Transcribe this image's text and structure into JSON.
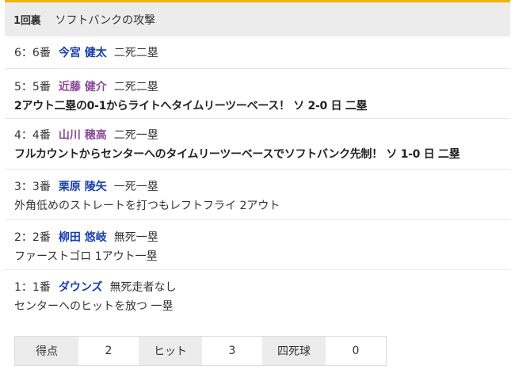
{
  "inning": {
    "label": "1回裏",
    "title": "ソフトバンクの攻撃"
  },
  "plays": [
    {
      "order": "6：6番",
      "batter": "今宮 健太",
      "situation": "二死二塁",
      "result": ""
    },
    {
      "order": "5：5番",
      "batter": "近藤 健介",
      "situation": "二死二塁",
      "result": "2アウト二塁の0-1からライトへタイムリーツーベース！ ソ 2-0 日 二塁"
    },
    {
      "order": "4：4番",
      "batter": "山川 穂高",
      "situation": "二死一塁",
      "result": "フルカウントからセンターへのタイムリーツーベースでソフトバンク先制！ ソ 1-0 日 二塁"
    },
    {
      "order": "3：3番",
      "batter": "栗原 陵矢",
      "situation": "一死一塁",
      "result": "外角低めのストレートを打つもレフトフライ 2アウト"
    },
    {
      "order": "2：2番",
      "batter": "柳田 悠岐",
      "situation": "無死一塁",
      "result": "ファーストゴロ 1アウト一塁"
    },
    {
      "order": "1：1番",
      "batter": "ダウンズ",
      "situation": "無死走者なし",
      "result": "センターへのヒットを放つ 一塁"
    }
  ],
  "summary": {
    "runs_label": "得点",
    "runs": "2",
    "hits_label": "ヒット",
    "hits": "3",
    "walks_label": "四死球",
    "walks": "0"
  },
  "colors": {
    "accent": "#f2b400",
    "batter_link": "#1a3ea8",
    "batter_scoring": "#8a4a9a",
    "header_bg": "#ececec"
  }
}
